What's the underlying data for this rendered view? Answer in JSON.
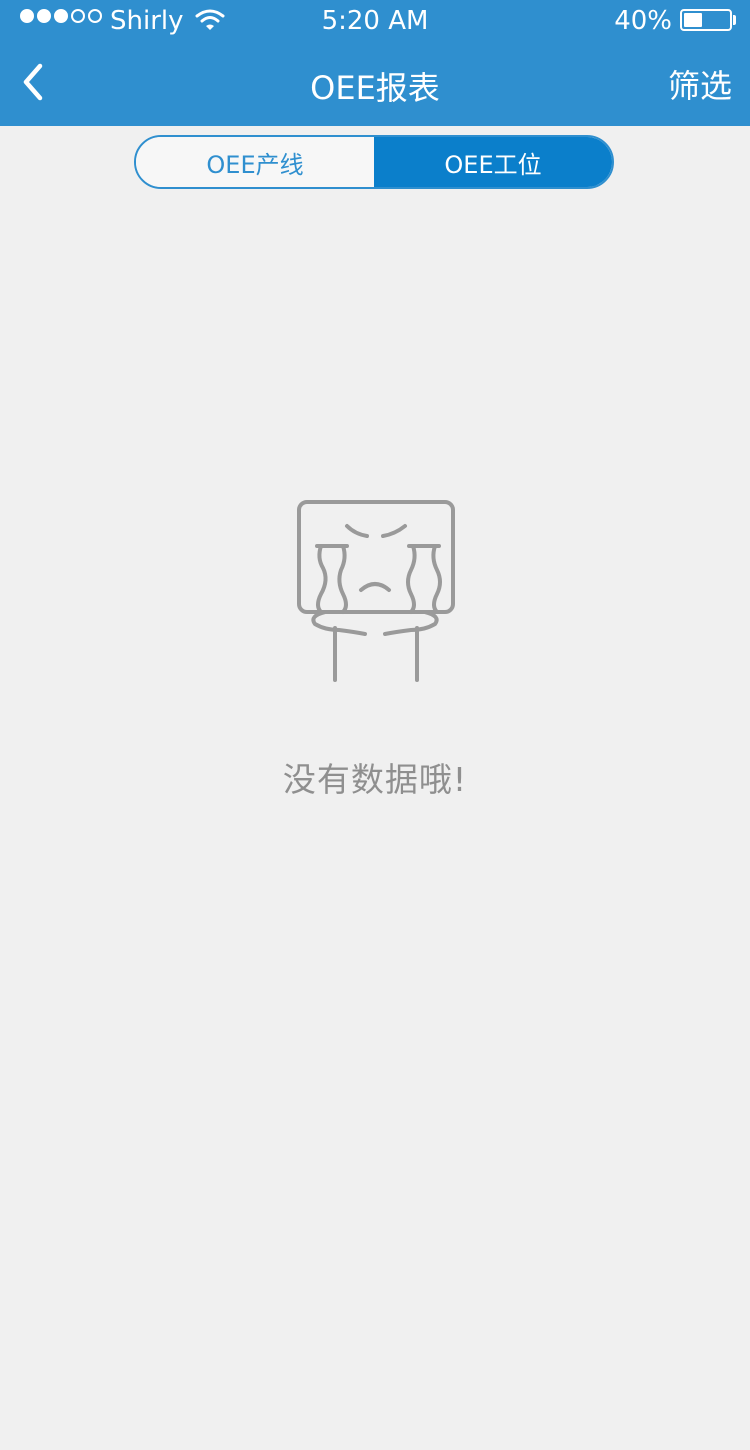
{
  "status_bar": {
    "carrier": "Shirly",
    "time": "5:20 AM",
    "battery_percent": "40%",
    "battery_level": 0.4,
    "signal_bars_filled": 3,
    "signal_bars_total": 5
  },
  "nav": {
    "title": "OEE报表",
    "filter_label": "筛选",
    "back_icon": "chevron-left-icon"
  },
  "tabs": [
    {
      "label": "OEE产线",
      "active": false
    },
    {
      "label": "OEE工位",
      "active": true
    }
  ],
  "empty_state": {
    "icon": "crying-face-icon",
    "message": "没有数据哦!"
  },
  "colors": {
    "header_bg": "#2f8fcf",
    "active_tab": "#0b7fcb",
    "page_bg": "#f0f0f0",
    "muted_text": "#8f8f8f"
  }
}
